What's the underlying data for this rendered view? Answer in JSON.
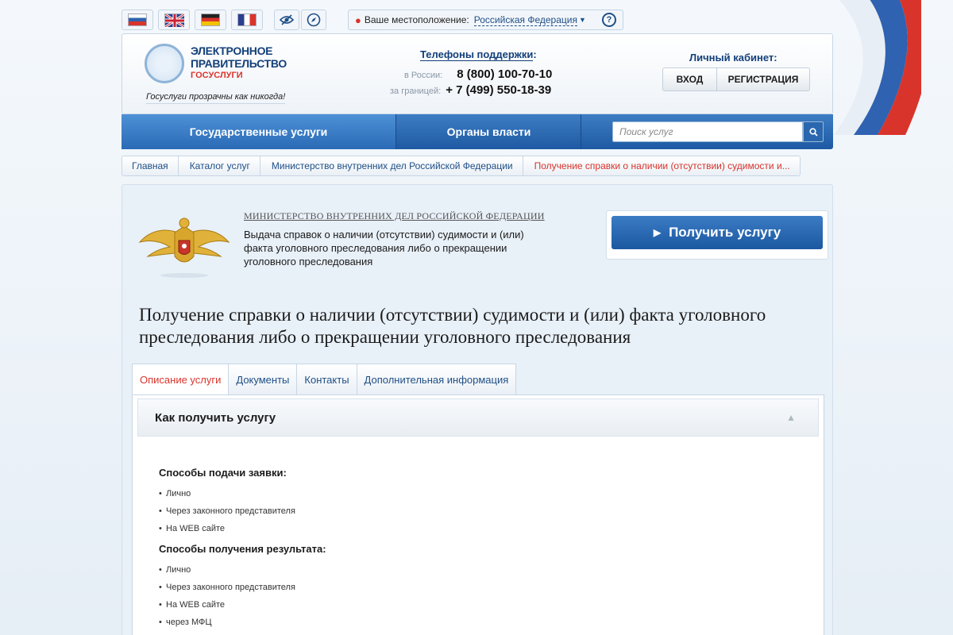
{
  "languages": [
    "Русский",
    "English",
    "Deutsch",
    "Français"
  ],
  "location": {
    "label": "Ваше местоположение:",
    "value": "Российская Федерация"
  },
  "logo": {
    "line1": "ЭЛЕКТРОННОЕ",
    "line2": "ПРАВИТЕЛЬСТВО",
    "line3": "ГОСУСЛУГИ",
    "slogan": "Госуслуги прозрачны как никогда!"
  },
  "support": {
    "title": "Телефоны поддержки",
    "russia_label": "в России:",
    "russia_phone": "8 (800) 100-70-10",
    "abroad_label": "за границей:",
    "abroad_phone": "+ 7 (499) 550-18-39"
  },
  "cabinet": {
    "title": "Личный кабинет:",
    "login": "ВХОД",
    "register": "РЕГИСТРАЦИЯ"
  },
  "nav": {
    "tab1": "Государственные услуги",
    "tab2": "Органы власти",
    "search_placeholder": "Поиск услуг"
  },
  "breadcrumbs": [
    "Главная",
    "Каталог услуг",
    "Министерство внутренних дел Российской Федерации",
    "Получение справки о наличии (отсутствии) судимости и..."
  ],
  "agency": "МИНИСТЕРСТВО ВНУТРЕННИХ ДЕЛ РОССИЙСКОЙ ФЕДЕРАЦИИ",
  "service_desc": "Выдача справок о наличии (отсутствии) судимости и (или) факта уголовного преследования либо о прекращении уголовного преследования",
  "get_service": "Получить услугу",
  "page_title": "Получение справки о наличии (отсутствии) судимости и (или) факта уголовного преследования либо о прекращении уголовного преследования",
  "tabs": [
    "Описание услуги",
    "Документы",
    "Контакты",
    "Дополнительная информация"
  ],
  "accordion_title": "Как получить услугу",
  "submit_methods": {
    "title": "Способы подачи заявки:",
    "items": [
      "Лично",
      "Через законного представителя",
      "На WEB сайте"
    ]
  },
  "result_methods": {
    "title": "Способы получения результата:",
    "items": [
      "Лично",
      "Через законного представителя",
      "На WEB сайте",
      "через МФЦ"
    ]
  },
  "colors": {
    "brand_blue": "#1e5aa3",
    "accent_red": "#d9342b",
    "link_blue": "#1f4f86"
  },
  "icons": [
    "location-pin-icon",
    "help-icon",
    "accessibility-eye-icon",
    "compass-icon",
    "search-icon",
    "chevron-right-icon",
    "chevron-up-icon"
  ]
}
